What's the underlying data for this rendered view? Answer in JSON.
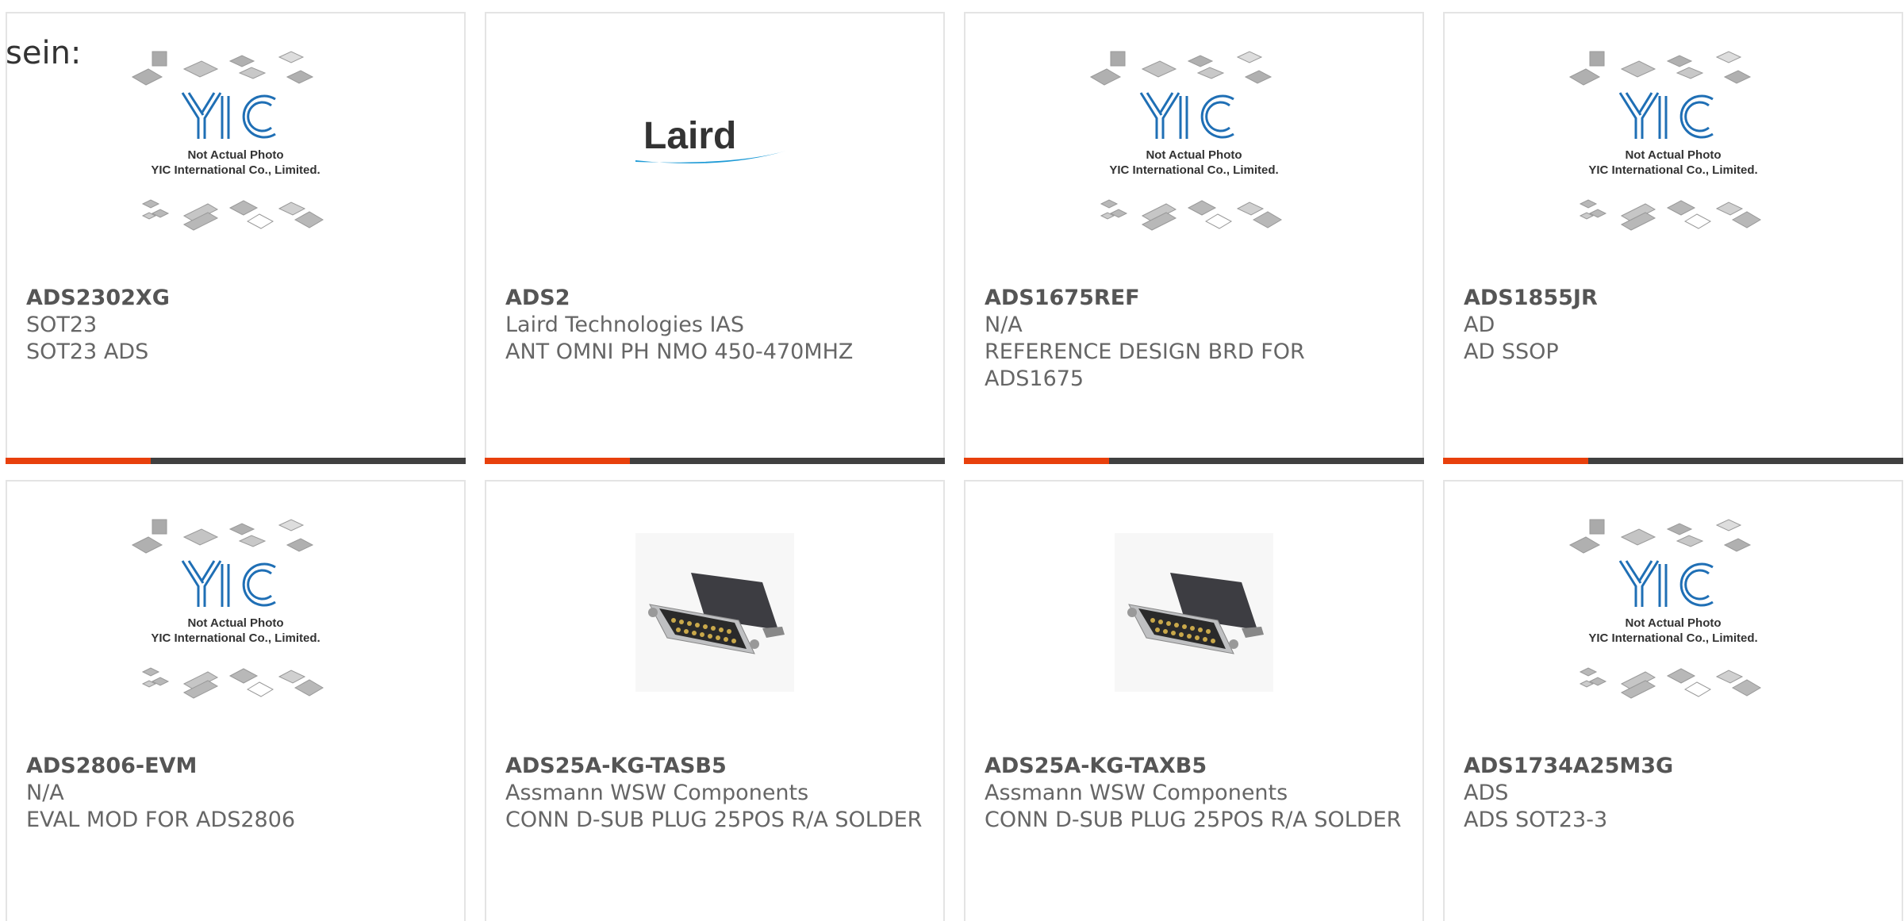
{
  "intro_text": "sein:",
  "placeholder_photo": {
    "line1": "Not Actual Photo",
    "line2": "YIC International Co., Limited."
  },
  "laird_logo_text": "Laird",
  "colors": {
    "accent": "#e8400c",
    "bar": "#404040",
    "border": "#e4e4e4",
    "yic_blue": "#1f6fb5",
    "laird_blue": "#1d9ad6"
  },
  "products": [
    {
      "part": "ADS2302XG",
      "manufacturer": "SOT23",
      "description": "SOT23 ADS",
      "image": "yic-placeholder"
    },
    {
      "part": "ADS2",
      "manufacturer": "Laird Technologies IAS",
      "description": "ANT OMNI PH NMO 450-470MHZ",
      "image": "laird-logo"
    },
    {
      "part": "ADS1675REF",
      "manufacturer": "N/A",
      "description": "REFERENCE DESIGN BRD FOR ADS1675",
      "image": "yic-placeholder"
    },
    {
      "part": "ADS1855JR",
      "manufacturer": "AD",
      "description": "AD SSOP",
      "image": "yic-placeholder"
    },
    {
      "part": "ADS2806-EVM",
      "manufacturer": "N/A",
      "description": "EVAL MOD FOR ADS2806",
      "image": "yic-placeholder"
    },
    {
      "part": "ADS25A-KG-TASB5",
      "manufacturer": "Assmann WSW Components",
      "description": "CONN D-SUB PLUG 25POS R/A SOLDER",
      "image": "dsub-connector"
    },
    {
      "part": "ADS25A-KG-TAXB5",
      "manufacturer": "Assmann WSW Components",
      "description": "CONN D-SUB PLUG 25POS R/A SOLDER",
      "image": "dsub-connector"
    },
    {
      "part": "ADS1734A25M3G",
      "manufacturer": "ADS",
      "description": "ADS SOT23-3",
      "image": "yic-placeholder"
    }
  ]
}
